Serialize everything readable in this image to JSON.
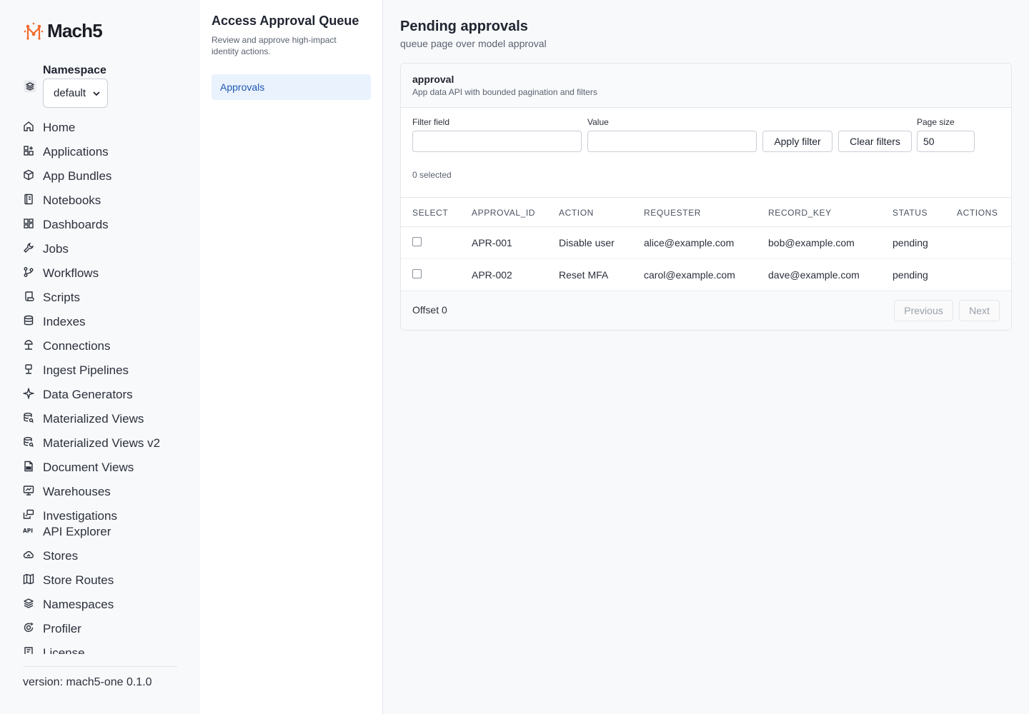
{
  "brand": {
    "name": "Mach5"
  },
  "namespace": {
    "label": "Namespace",
    "selected": "default"
  },
  "nav": [
    {
      "label": "Home",
      "icon": "home-icon"
    },
    {
      "label": "Applications",
      "icon": "apps-icon"
    },
    {
      "label": "App Bundles",
      "icon": "package-icon"
    },
    {
      "label": "Notebooks",
      "icon": "notebook-icon"
    },
    {
      "label": "Dashboards",
      "icon": "dashboard-icon"
    },
    {
      "label": "Jobs",
      "icon": "wrench-icon"
    },
    {
      "label": "Workflows",
      "icon": "workflow-icon"
    },
    {
      "label": "Scripts",
      "icon": "script-icon"
    },
    {
      "label": "Indexes",
      "icon": "database-icon"
    },
    {
      "label": "Connections",
      "icon": "connection-icon"
    },
    {
      "label": "Ingest Pipelines",
      "icon": "pipeline-icon"
    },
    {
      "label": "Data Generators",
      "icon": "sparkle-icon"
    },
    {
      "label": "Materialized Views",
      "icon": "view-search-icon"
    },
    {
      "label": "Materialized Views v2",
      "icon": "view-search-icon"
    },
    {
      "label": "Document Views",
      "icon": "document-icon"
    },
    {
      "label": "Warehouses",
      "icon": "monitor-icon"
    },
    {
      "label": "Investigations",
      "icon": "investigation-icon"
    },
    {
      "label": "API Explorer",
      "icon": "api-icon"
    },
    {
      "label": "Stores",
      "icon": "cloud-icon"
    },
    {
      "label": "Store Routes",
      "icon": "map-icon"
    },
    {
      "label": "Namespaces",
      "icon": "layers-icon"
    },
    {
      "label": "Profiler",
      "icon": "profiler-icon"
    },
    {
      "label": "License",
      "icon": "license-icon"
    }
  ],
  "version": "version: mach5-one 0.1.0",
  "subpanel": {
    "title": "Access Approval Queue",
    "description": "Review and approve high-impact identity actions.",
    "items": [
      {
        "label": "Approvals"
      }
    ]
  },
  "page": {
    "title": "Pending approvals",
    "subtitle": "queue page over model approval"
  },
  "card": {
    "title": "approval",
    "subtitle": "App data API with bounded pagination and filters",
    "filters": {
      "field_label": "Filter field",
      "field_value": "",
      "value_label": "Value",
      "value_value": "",
      "apply_label": "Apply filter",
      "clear_label": "Clear filters",
      "page_size_label": "Page size",
      "page_size_value": "50"
    },
    "selected_text": "0 selected",
    "columns": [
      "SELECT",
      "APPROVAL_ID",
      "ACTION",
      "REQUESTER",
      "RECORD_KEY",
      "STATUS",
      "ACTIONS"
    ],
    "rows": [
      {
        "approval_id": "APR-001",
        "action": "Disable user",
        "requester": "alice@example.com",
        "record_key": "bob@example.com",
        "status": "pending"
      },
      {
        "approval_id": "APR-002",
        "action": "Reset MFA",
        "requester": "carol@example.com",
        "record_key": "dave@example.com",
        "status": "pending"
      }
    ],
    "footer": {
      "offset_text": "Offset 0",
      "previous_label": "Previous",
      "next_label": "Next"
    }
  },
  "colors": {
    "accent": "#1d57b5",
    "brand": "#f26a2e",
    "active_bg": "#eaf2fd"
  }
}
